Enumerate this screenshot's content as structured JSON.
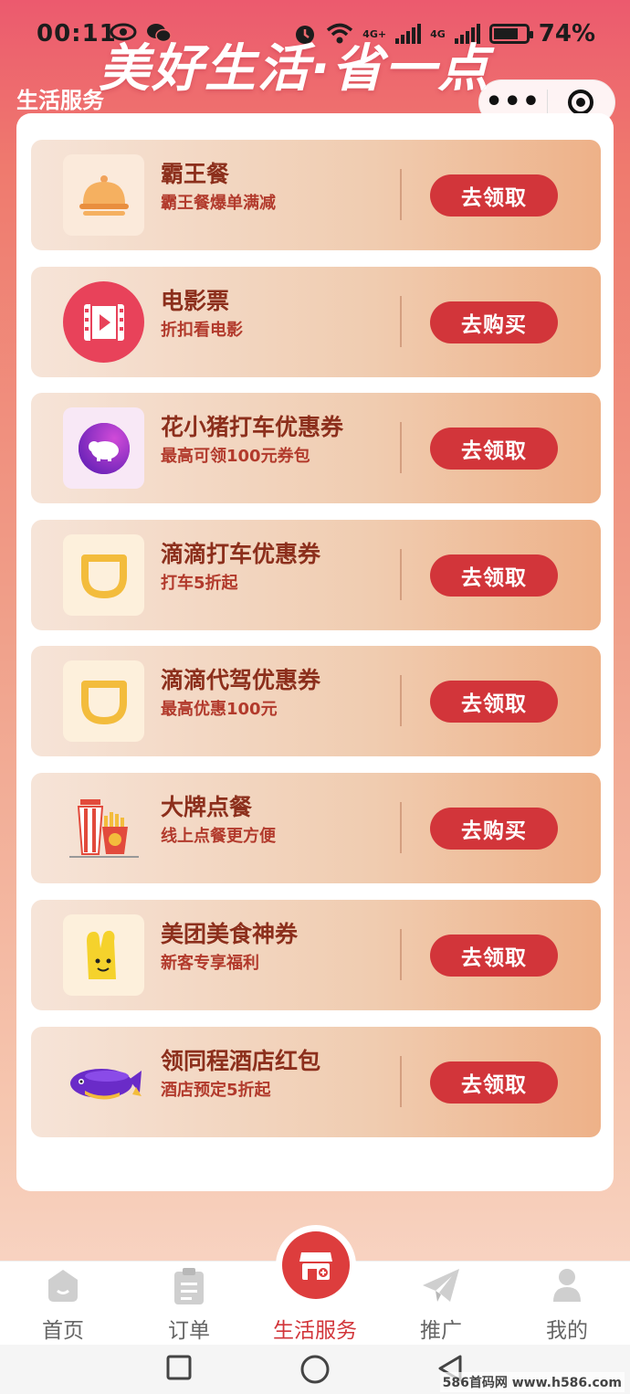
{
  "status_bar": {
    "time": "00:11",
    "net_label_1": "4G+",
    "net_label_2": "4G",
    "battery_percent": "74%"
  },
  "banner_title": "美好生活·省一点",
  "page_title": "生活服务",
  "capsule": {
    "more_label": "•••"
  },
  "cards": [
    {
      "title": "霸王餐",
      "subtitle": "霸王餐爆单满减",
      "button": "去领取",
      "icon": "food-cover-icon"
    },
    {
      "title": "电影票",
      "subtitle": "折扣看电影",
      "button": "去购买",
      "icon": "movie-film-icon"
    },
    {
      "title": "花小猪打车优惠券",
      "subtitle": "最高可领100元券包",
      "button": "去领取",
      "icon": "huaxiaozhu-pig-icon"
    },
    {
      "title": "滴滴打车优惠券",
      "subtitle": "打车5折起",
      "button": "去领取",
      "icon": "didi-logo-icon"
    },
    {
      "title": "滴滴代驾优惠券",
      "subtitle": "最高优惠100元",
      "button": "去领取",
      "icon": "didi-logo-icon"
    },
    {
      "title": "大牌点餐",
      "subtitle": "线上点餐更方便",
      "button": "去购买",
      "icon": "fastfood-icon"
    },
    {
      "title": "美团美食神券",
      "subtitle": "新客专享福利",
      "button": "去领取",
      "icon": "meituan-mascot-icon"
    },
    {
      "title": "领同程酒店红包",
      "subtitle": "酒店预定5折起",
      "button": "去领取",
      "icon": "tongcheng-whale-icon"
    }
  ],
  "tabs": [
    {
      "label": "首页",
      "icon": "home-icon",
      "active": false
    },
    {
      "label": "订单",
      "icon": "clipboard-icon",
      "active": false
    },
    {
      "label": "生活服务",
      "icon": "store-icon",
      "active": true
    },
    {
      "label": "推广",
      "icon": "paper-plane-icon",
      "active": false
    },
    {
      "label": "我的",
      "icon": "user-icon",
      "active": false
    }
  ],
  "watermark": "586首码网 www.h586.com",
  "colors": {
    "accent": "#d2353a",
    "title_brown": "#8c2f1c",
    "subtitle_red": "#b23a2c"
  }
}
